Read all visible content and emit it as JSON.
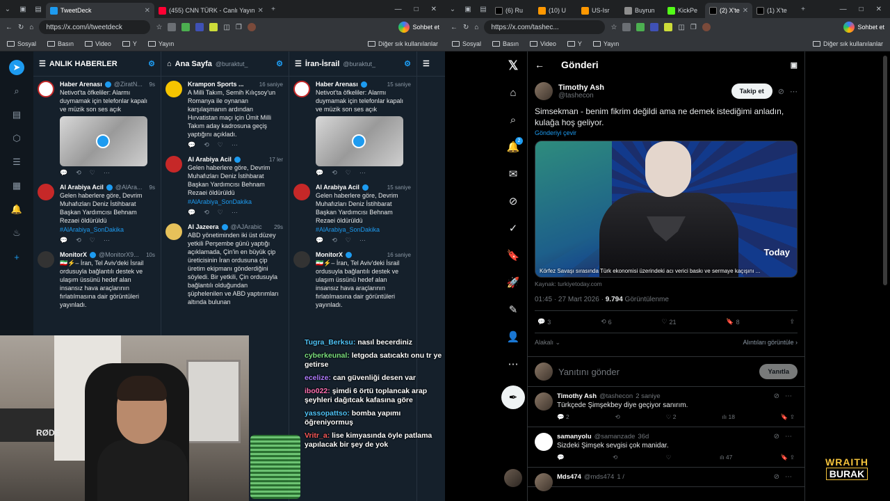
{
  "left_browser": {
    "tabs": [
      {
        "label": "TweetDeck",
        "active": true
      },
      {
        "label": "(455) CNN TÜRK - Canlı Yayın",
        "active": false
      }
    ],
    "url": "https://x.com/i/tweetdeck",
    "chat_label": "Sohbet et",
    "bookmarks": [
      "Sosyal",
      "Basın",
      "Video",
      "Y",
      "Yayın"
    ],
    "other_bookmarks": "Diğer sık kullanılanlar"
  },
  "deck": {
    "columns": [
      {
        "title": "ANLIK HABERLER",
        "sub": "",
        "tweets": [
          {
            "name": "Haber Arenası",
            "handle": "@ZiratN...",
            "time": "9s",
            "text": "Netivot'ta öfkeliler: Alarmı duymamak için telefonlar kapalı ve müzik son ses açık",
            "media": true
          },
          {
            "name": "Al Arabiya Acil",
            "handle": "@AlAra...",
            "time": "9s",
            "text": "Gelen haberlere göre, Devrim Muhafızları Deniz İstihbarat Başkan Yardımcısı Behnam Rezaei öldürüldü",
            "tag": "#AlArabiya_SonDakika"
          },
          {
            "name": "MonitorX",
            "handle": "@MonitorX9...",
            "time": "10s",
            "text": "🇮🇷⚡– İran, Tel Aviv'deki İsrail ordusuyla bağlantılı destek ve ulaşım üssünü hedef alan insansız hava araçlarının fırlatılmasına dair görüntüleri yayınladı."
          }
        ]
      },
      {
        "title": "Ana Sayfa",
        "sub": "@buraktut_",
        "tweets": [
          {
            "name": "Krampon Sports ...",
            "handle": "",
            "time": "16 saniye",
            "text": "A Milli Takım, Semih Kılıçsoy'un Romanya ile oynanan karşılaşmanın ardından Hırvatistan maçı için Ümit Milli Takım aday kadrosuna geçiş yaptığını açıkladı."
          },
          {
            "name": "Al Arabiya Acil",
            "handle": "",
            "time": "17 ler",
            "text": "Gelen haberlere göre, Devrim Muhafızları Deniz İstihbarat Başkan Yardımcısı Behnam Rezaei öldürüldü",
            "tag": "#AlArabiya_SonDakika"
          },
          {
            "name": "Al Jazeera",
            "handle": "@AJArabic",
            "time": "29s",
            "text": "ABD yönetiminden iki üst düzey yetkili Perşembe günü yaptığı açıklamada, Çin'in en büyük çip üreticisinin İran ordusuna çip üretim ekipmanı gönderdiğini söyledi. Bir yetkili, Çin ordusuyla bağlantılı olduğundan şüphelenilen ve ABD yaptırımları altında bulunan"
          }
        ]
      },
      {
        "title": "İran-İsrail",
        "sub": "@buraktut_",
        "tweets": [
          {
            "name": "Haber Arenası",
            "handle": "",
            "time": "15 saniye",
            "text": "Netivot'ta öfkeliler: Alarmı duymamak için telefonlar kapalı ve müzik son ses açık",
            "media": true
          },
          {
            "name": "Al Arabiya Acil",
            "handle": "",
            "time": "15 saniye",
            "text": "Gelen haberlere göre, Devrim Muhafızları Deniz İstihbarat Başkan Yardımcısı Behnam Rezaei öldürüldü",
            "tag": "#AlArabiya_SonDakika"
          },
          {
            "name": "MonitorX",
            "handle": "",
            "time": "16 saniye",
            "text": "🇮🇷⚡– İran, Tel Aviv'deki İsrail ordusuyla bağlantılı destek ve ulaşım üssünü hedef alan insansız hava araçlarının fırlatılmasına dair görüntüleri yayınladı."
          }
        ]
      }
    ]
  },
  "stream_chat": [
    {
      "user": "Tugra_Berksu:",
      "text": "nasıl becerdiniz",
      "color": "#4fc3f7"
    },
    {
      "user": "cyberkeunal:",
      "text": "letgoda satıcaktı onu tr ye getirse",
      "color": "#7be07f"
    },
    {
      "user": "ecelize:",
      "text": "can güvenliği desen var",
      "color": "#b07cff"
    },
    {
      "user": "ibo022:",
      "text": "şimdi 6 örtü toplancak arap şeyhleri dağıtcak kafasına göre",
      "color": "#ff6fb0"
    },
    {
      "user": "yassopattso:",
      "text": "bomba yapımı öğreniyormuş",
      "color": "#4fc3f7"
    },
    {
      "user": "Vritr_a:",
      "text": "lise kimyasında öyle patlama yapılacak bir şey de yok",
      "color": "#ff5a5a"
    }
  ],
  "webcam": {
    "mic_brand": "RØDE"
  },
  "right_browser": {
    "tabs": [
      "(6) Ru",
      "(10) U",
      "US-Isr",
      "Buyrun",
      "KickPe",
      "(2) X'te",
      "(1) X'te"
    ],
    "url": "https://x.com/tashec...",
    "chat_label": "Sohbet et",
    "bookmarks": [
      "Sosyal",
      "Basın",
      "Video",
      "Y",
      "Yayın"
    ],
    "other_bookmarks": "Diğer sık kullanılanlar"
  },
  "x_post": {
    "header": "Gönderi",
    "author_name": "Timothy Ash",
    "author_handle": "@tashecon",
    "follow_label": "Takip et",
    "text": "Simsekman - benim fikrim değildi ama ne demek istediğimi anladın, kulağa hoş geliyor.",
    "translate_label": "Gönderiyi çevir",
    "image_caption": "Körfez Savaşı sırasında Türk ekonomisi üzerindeki acı verici baskı ve sermaye kaçışını ...",
    "image_brand": "Today",
    "source": "Kaynak: turkiyetoday.com",
    "time": "01:45 · 27 Mart 2026 ·",
    "views_count": "9.794",
    "views_label": "Görüntülenme",
    "replies": "3",
    "reposts": "6",
    "likes": "21",
    "bookmarks": "8",
    "sort_label": "Alakalı",
    "quotes_label": "Alıntıları görüntüle",
    "reply_placeholder": "Yanıtını gönder",
    "reply_button": "Yanıtla",
    "notification_badge": "2"
  },
  "x_replies": [
    {
      "name": "Timothy Ash",
      "handle": "@tashecon",
      "time": "2 saniye",
      "text": "Türkçede Şimşekbey diye geçiyor sanırım.",
      "replies": "2",
      "likes": "2",
      "views": "18"
    },
    {
      "name": "samanyolu",
      "handle": "@samanzade",
      "time": "36d",
      "text": "Sizdeki Şimşek sevgisi çok manidar.",
      "replies": "",
      "likes": "",
      "views": "47"
    },
    {
      "name": "Mds474",
      "handle": "@mds474",
      "time": "1 /",
      "text": "",
      "replies": "",
      "likes": "",
      "views": ""
    }
  ],
  "overlay_logo": {
    "line1": "WRAITH",
    "line2": "BURAK"
  }
}
